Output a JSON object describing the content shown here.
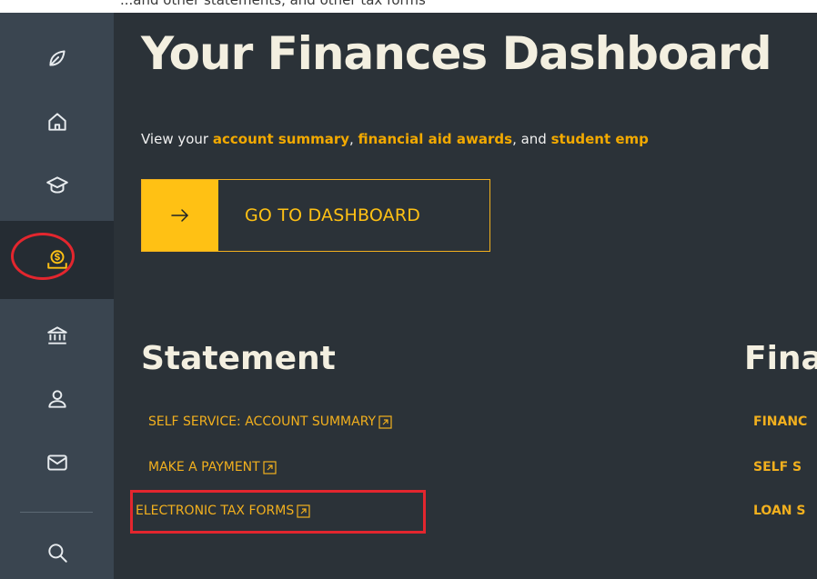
{
  "top_strip": {
    "text": "...and other statements, and other tax forms"
  },
  "sidebar": {
    "items": [
      {
        "icon": "leaf-icon"
      },
      {
        "icon": "home-icon"
      },
      {
        "icon": "graduation-cap-icon"
      },
      {
        "icon": "finances-icon",
        "active": true
      },
      {
        "icon": "bank-icon"
      },
      {
        "icon": "person-icon"
      },
      {
        "icon": "mail-icon"
      },
      {
        "icon": "search-icon"
      }
    ]
  },
  "main": {
    "title": "Your Finances Dashboard",
    "intro": {
      "prefix": "View your ",
      "link1": "account summary",
      "sep1": ", ",
      "link2": "financial aid awards",
      "sep2": ", and ",
      "link3": "student emp"
    },
    "dashboard_button": {
      "arrow": "→",
      "label": "GO TO DASHBOARD"
    },
    "statement": {
      "title": "Statement",
      "links": [
        "SELF SERVICE: ACCOUNT SUMMARY",
        "MAKE A PAYMENT",
        "ELECTRONIC TAX FORMS"
      ]
    },
    "financial_aid": {
      "title": "Fina",
      "links": [
        "FINANC",
        "SELF S",
        "LOAN S"
      ]
    }
  },
  "colors": {
    "background": "#2b3238",
    "sidebar": "#3a4550",
    "sidebar_active": "#252c33",
    "accent": "#ffc114",
    "link": "#f2b01e",
    "heading": "#f3efe0",
    "annotation_red": "#e3262e"
  }
}
